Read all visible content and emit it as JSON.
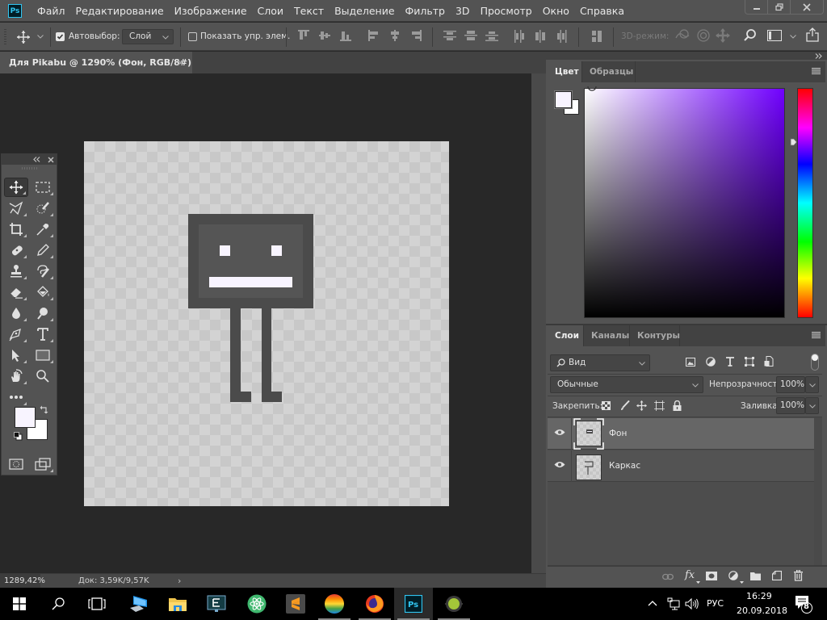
{
  "app": {
    "logo": "Ps",
    "menu": [
      "Файл",
      "Редактирование",
      "Изображение",
      "Слои",
      "Текст",
      "Выделение",
      "Фильтр",
      "3D",
      "Просмотр",
      "Окно",
      "Справка"
    ],
    "window_controls": [
      "minimize",
      "restore",
      "close"
    ]
  },
  "options_bar": {
    "tool_icon": "move-icon",
    "auto_select_label": "Автовыбор:",
    "auto_select_checked": true,
    "auto_select_target": "Слой",
    "show_transform_label": "Показать упр. элем.",
    "show_transform_checked": false,
    "mode_3d_label": "3D-режим:"
  },
  "document": {
    "tab_title": "Для Pikabu @ 1290% (Фон, RGB/8#) *",
    "close_glyph": "×",
    "artwork": {
      "frame_color": "#4b4b4b",
      "face_color": "#555555",
      "feature_color": "#f8f4ff"
    }
  },
  "status_bar": {
    "zoom": "1289,42%",
    "doc_info": "Док: 3,59K/9,57K",
    "arrow": "›"
  },
  "toolbox": {
    "tools": [
      {
        "name": "move-tool",
        "active": true
      },
      {
        "name": "marquee-tool"
      },
      {
        "name": "lasso-tool"
      },
      {
        "name": "quick-selection-tool"
      },
      {
        "name": "crop-tool"
      },
      {
        "name": "eyedropper-tool"
      },
      {
        "name": "healing-brush-tool"
      },
      {
        "name": "brush-tool"
      },
      {
        "name": "clone-stamp-tool"
      },
      {
        "name": "history-brush-tool"
      },
      {
        "name": "eraser-tool"
      },
      {
        "name": "paint-bucket-tool"
      },
      {
        "name": "blur-tool"
      },
      {
        "name": "dodge-tool"
      },
      {
        "name": "pen-tool"
      },
      {
        "name": "type-tool"
      },
      {
        "name": "path-selection-tool"
      },
      {
        "name": "rectangle-tool"
      },
      {
        "name": "hand-tool"
      },
      {
        "name": "zoom-tool"
      },
      {
        "name": "more-tools"
      }
    ],
    "foreground_color": "#f8f4ff",
    "background_color": "#ffffff"
  },
  "color_panel": {
    "tabs": [
      {
        "label": "Цвет",
        "active": true
      },
      {
        "label": "Образцы",
        "active": false
      }
    ],
    "foreground_color": "#f8f4ff",
    "background_color": "#ffffff",
    "hue_color": "#7000ff"
  },
  "layers_panel": {
    "tabs": [
      {
        "label": "Слои",
        "active": true
      },
      {
        "label": "Каналы",
        "active": false
      },
      {
        "label": "Контуры",
        "active": false
      }
    ],
    "filter_label": "Вид",
    "blend_mode": "Обычные",
    "opacity_label": "Непрозрачность:",
    "opacity_value": "100%",
    "lock_label": "Закрепить:",
    "fill_label": "Заливка:",
    "fill_value": "100%",
    "layers": [
      {
        "name": "Фон",
        "visible": true,
        "selected": true
      },
      {
        "name": "Каркас",
        "visible": true,
        "selected": false
      }
    ]
  },
  "taskbar": {
    "apps": [
      "start",
      "search",
      "task-view",
      "computer",
      "file-explorer",
      "app-e",
      "atom",
      "sublime-text",
      "chrome-like",
      "firefox",
      "photoshop",
      "android-studio"
    ],
    "tray": {
      "language": "РУС",
      "time": "16:29",
      "date": "20.09.2018",
      "notifications": "8"
    }
  }
}
